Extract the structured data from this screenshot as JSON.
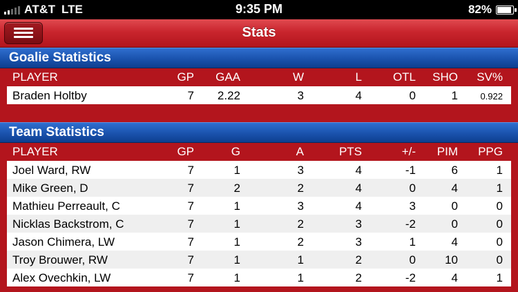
{
  "status_bar": {
    "carrier": "AT&T",
    "network": "LTE",
    "time": "9:35 PM",
    "battery": "82%",
    "battery_level": 0.82
  },
  "nav": {
    "title": "Stats",
    "menu_icon": "hamburger-menu-icon"
  },
  "goalie": {
    "section_title": "Goalie Statistics",
    "columns": [
      "PLAYER",
      "GP",
      "GAA",
      "W",
      "L",
      "OTL",
      "SHO",
      "SV%"
    ],
    "rows": [
      [
        "Braden Holtby",
        "7",
        "2.22",
        "3",
        "4",
        "0",
        "1",
        "0.922"
      ]
    ]
  },
  "team": {
    "section_title": "Team Statistics",
    "columns": [
      "PLAYER",
      "GP",
      "G",
      "A",
      "PTS",
      "+/-",
      "PIM",
      "PPG"
    ],
    "rows": [
      [
        "Joel Ward, RW",
        "7",
        "1",
        "3",
        "4",
        "-1",
        "6",
        "1"
      ],
      [
        "Mike Green, D",
        "7",
        "2",
        "2",
        "4",
        "0",
        "4",
        "1"
      ],
      [
        "Mathieu Perreault, C",
        "7",
        "1",
        "3",
        "4",
        "3",
        "0",
        "0"
      ],
      [
        "Nicklas Backstrom, C",
        "7",
        "1",
        "2",
        "3",
        "-2",
        "0",
        "0"
      ],
      [
        "Jason Chimera, LW",
        "7",
        "1",
        "2",
        "3",
        "1",
        "4",
        "0"
      ],
      [
        "Troy Brouwer, RW",
        "7",
        "1",
        "1",
        "2",
        "0",
        "10",
        "0"
      ],
      [
        "Alex Ovechkin, LW",
        "7",
        "1",
        "1",
        "2",
        "-2",
        "4",
        "1"
      ]
    ]
  }
}
